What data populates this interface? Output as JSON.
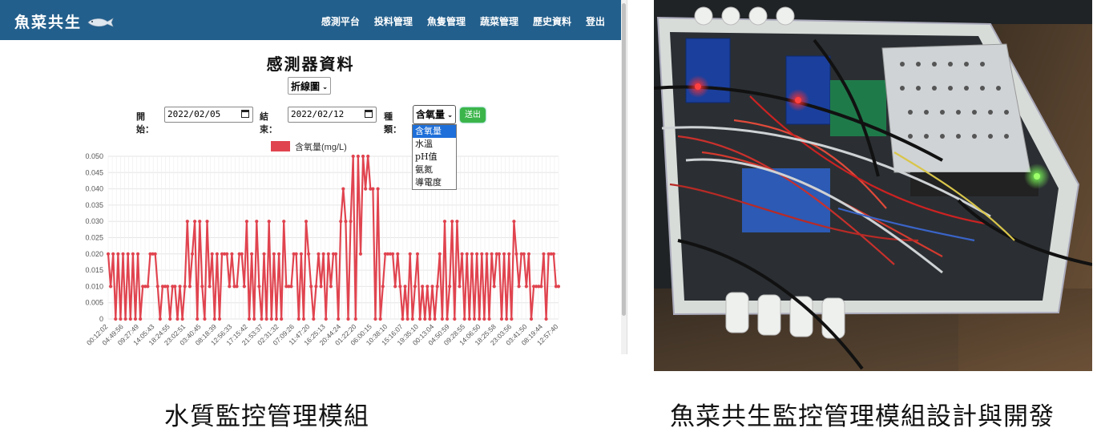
{
  "app": {
    "brand": "魚菜共生",
    "nav": [
      "感測平台",
      "投料管理",
      "魚隻管理",
      "蔬菜管理",
      "歷史資料",
      "登出"
    ]
  },
  "page": {
    "title": "感測器資料",
    "chart_type_select": "折線圖"
  },
  "filters": {
    "start_label": "開始：",
    "start_value": "2022/02/05",
    "end_label": "結束：",
    "end_value": "2022/02/12",
    "type_label": "種類：",
    "type_value": "含氧量",
    "submit": "送出",
    "type_options": [
      "含氧量",
      "水溫",
      "pH值",
      "氨氮",
      "導電度"
    ],
    "selected_option_index": 0
  },
  "chart_data": {
    "type": "line",
    "series": [
      {
        "name": "含氧量(mg/L)",
        "color": "#e0444f"
      }
    ],
    "ylim": [
      0,
      0.05
    ],
    "yticks": [
      "0",
      "0.005",
      "0.010",
      "0.015",
      "0.020",
      "0.025",
      "0.030",
      "0.035",
      "0.040",
      "0.045",
      "0.050"
    ],
    "xticks": [
      "00:12:02",
      "04:49:56",
      "09:27:49",
      "14:05:43",
      "18:24:55",
      "23:02:51",
      "03:40:45",
      "08:18:39",
      "12:56:33",
      "17:15:42",
      "21:53:37",
      "02:31:32",
      "07:09:26",
      "11:47:20",
      "16:25:13",
      "20:44:24",
      "01:22:20",
      "06:00:15",
      "10:38:10",
      "15:16:07",
      "19:35:10",
      "00:13:04",
      "04:50:59",
      "09:28:55",
      "14:06:50",
      "18:25:58",
      "23:03:56",
      "03:41:50",
      "08:19:44",
      "12:57:40"
    ],
    "values": [
      0.02,
      0.01,
      0.02,
      0.0,
      0.02,
      0.0,
      0.02,
      0.0,
      0.02,
      0.0,
      0.02,
      0.0,
      0.02,
      0.0,
      0.01,
      0.01,
      0.01,
      0.02,
      0.02,
      0.02,
      0.01,
      0.0,
      0.01,
      0.01,
      0.01,
      0.0,
      0.01,
      0.01,
      0.0,
      0.01,
      0.0,
      0.01,
      0.03,
      0.01,
      0.02,
      0.03,
      0.0,
      0.03,
      0.01,
      0.0,
      0.03,
      0.01,
      0.02,
      0.0,
      0.02,
      0.0,
      0.02,
      0.02,
      0.02,
      0.01,
      0.02,
      0.01,
      0.01,
      0.02,
      0.02,
      0.01,
      0.03,
      0.0,
      0.02,
      0.0,
      0.03,
      0.01,
      0.0,
      0.02,
      0.0,
      0.03,
      0.0,
      0.02,
      0.0,
      0.02,
      0.0,
      0.03,
      0.01,
      0.01,
      0.01,
      0.02,
      0.02,
      0.0,
      0.02,
      0.0,
      0.03,
      0.02,
      0.01,
      0.0,
      0.01,
      0.02,
      0.01,
      0.02,
      0.0,
      0.02,
      0.01,
      0.02,
      0.02,
      0.0,
      0.03,
      0.04,
      0.03,
      0.0,
      0.03,
      0.05,
      0.0,
      0.05,
      0.02,
      0.05,
      0.04,
      0.05,
      0.04,
      0.04,
      0.0,
      0.04,
      0.0,
      0.01,
      0.02,
      0.02,
      0.02,
      0.02,
      0.01,
      0.02,
      0.01,
      0.0,
      0.01,
      0.0,
      0.02,
      0.0,
      0.01,
      0.02,
      0.0,
      0.01,
      0.0,
      0.01,
      0.0,
      0.01,
      0.0,
      0.01,
      0.02,
      0.0,
      0.03,
      0.0,
      0.01,
      0.03,
      0.0,
      0.03,
      0.01,
      0.02,
      0.0,
      0.02,
      0.0,
      0.02,
      0.0,
      0.02,
      0.0,
      0.02,
      0.0,
      0.02,
      0.0,
      0.02,
      0.01,
      0.02,
      0.02,
      0.0,
      0.02,
      0.0,
      0.02,
      0.0,
      0.03,
      0.02,
      0.01,
      0.02,
      0.02,
      0.01,
      0.02,
      0.0,
      0.01,
      0.01,
      0.01,
      0.01,
      0.02,
      0.0,
      0.02,
      0.02,
      0.02,
      0.01,
      0.01
    ]
  },
  "captions": {
    "left": "水質監控管理模組",
    "right": "魚菜共生監控管理模組設計與開發"
  }
}
